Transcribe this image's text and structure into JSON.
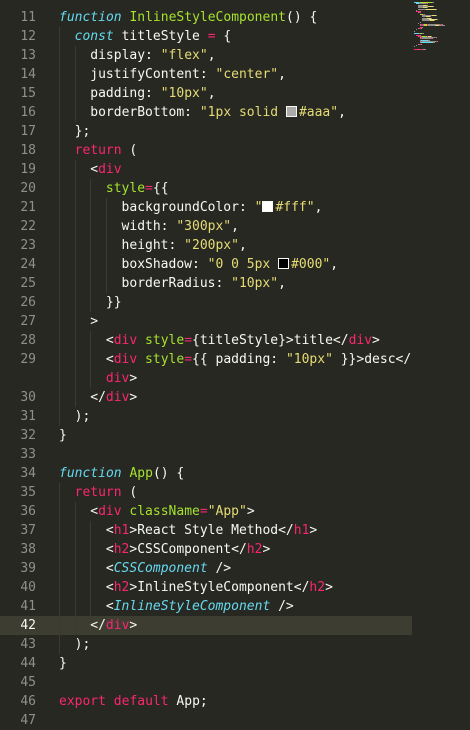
{
  "colors": {
    "background": "#272822",
    "active_line": "#3e3d32",
    "keyword": "#f92672",
    "function": "#a6e22e",
    "string": "#e6db74",
    "component": "#66d9ef",
    "text": "#f8f8f2",
    "line_number": "#90908a"
  },
  "editor": {
    "current_line": "42",
    "lines": [
      {
        "num": "11",
        "indent": 0,
        "tokens": [
          {
            "t": "function",
            "c": "kwi"
          },
          {
            "t": " "
          },
          {
            "t": "InlineStyleComponent",
            "c": "fn"
          },
          {
            "t": "() {"
          }
        ]
      },
      {
        "num": "12",
        "indent": 1,
        "tokens": [
          {
            "t": "const",
            "c": "kwi"
          },
          {
            "t": " titleStyle "
          },
          {
            "t": "=",
            "c": "kw"
          },
          {
            "t": " {"
          }
        ]
      },
      {
        "num": "13",
        "indent": 2,
        "tokens": [
          {
            "t": "display: "
          },
          {
            "t": "\"flex\"",
            "c": "str"
          },
          {
            "t": ","
          }
        ]
      },
      {
        "num": "14",
        "indent": 2,
        "tokens": [
          {
            "t": "justifyContent: "
          },
          {
            "t": "\"center\"",
            "c": "str"
          },
          {
            "t": ","
          }
        ]
      },
      {
        "num": "15",
        "indent": 2,
        "tokens": [
          {
            "t": "padding: "
          },
          {
            "t": "\"10px\"",
            "c": "str"
          },
          {
            "t": ","
          }
        ]
      },
      {
        "num": "16",
        "indent": 2,
        "tokens": [
          {
            "t": "borderBottom: "
          },
          {
            "t": "\"1px solid ",
            "c": "str"
          },
          {
            "t": "",
            "swatch": "#aaaaaa"
          },
          {
            "t": "#aaa\"",
            "c": "str"
          },
          {
            "t": ","
          }
        ]
      },
      {
        "num": "17",
        "indent": 1,
        "tokens": [
          {
            "t": "};"
          }
        ]
      },
      {
        "num": "18",
        "indent": 1,
        "tokens": [
          {
            "t": "return",
            "c": "kw"
          },
          {
            "t": " ("
          }
        ]
      },
      {
        "num": "19",
        "indent": 2,
        "tokens": [
          {
            "t": "<"
          },
          {
            "t": "div",
            "c": "tag"
          }
        ]
      },
      {
        "num": "20",
        "indent": 3,
        "tokens": [
          {
            "t": "style",
            "c": "attr"
          },
          {
            "t": "=",
            "c": "kw"
          },
          {
            "t": "{{"
          }
        ]
      },
      {
        "num": "21",
        "indent": 4,
        "tokens": [
          {
            "t": "backgroundColor: "
          },
          {
            "t": "\"",
            "c": "str"
          },
          {
            "t": "",
            "swatch": "#ffffff"
          },
          {
            "t": "#fff\"",
            "c": "str"
          },
          {
            "t": ","
          }
        ]
      },
      {
        "num": "22",
        "indent": 4,
        "tokens": [
          {
            "t": "width: "
          },
          {
            "t": "\"300px\"",
            "c": "str"
          },
          {
            "t": ","
          }
        ]
      },
      {
        "num": "23",
        "indent": 4,
        "tokens": [
          {
            "t": "height: "
          },
          {
            "t": "\"200px\"",
            "c": "str"
          },
          {
            "t": ","
          }
        ]
      },
      {
        "num": "24",
        "indent": 4,
        "tokens": [
          {
            "t": "boxShadow: "
          },
          {
            "t": "\"0 0 5px ",
            "c": "str"
          },
          {
            "t": "",
            "swatch": "#000000"
          },
          {
            "t": "#000\"",
            "c": "str"
          },
          {
            "t": ","
          }
        ]
      },
      {
        "num": "25",
        "indent": 4,
        "tokens": [
          {
            "t": "borderRadius: "
          },
          {
            "t": "\"10px\"",
            "c": "str"
          },
          {
            "t": ","
          }
        ]
      },
      {
        "num": "26",
        "indent": 3,
        "tokens": [
          {
            "t": "}}"
          }
        ]
      },
      {
        "num": "27",
        "indent": 2,
        "tokens": [
          {
            "t": ">"
          }
        ]
      },
      {
        "num": "28",
        "indent": 3,
        "tokens": [
          {
            "t": "<"
          },
          {
            "t": "div",
            "c": "tag"
          },
          {
            "t": " "
          },
          {
            "t": "style",
            "c": "attr"
          },
          {
            "t": "=",
            "c": "kw"
          },
          {
            "t": "{titleStyle}>title</"
          },
          {
            "t": "div",
            "c": "tag"
          },
          {
            "t": ">"
          }
        ]
      },
      {
        "num": "29",
        "indent": 3,
        "tokens": [
          {
            "t": "<"
          },
          {
            "t": "div",
            "c": "tag"
          },
          {
            "t": " "
          },
          {
            "t": "style",
            "c": "attr"
          },
          {
            "t": "=",
            "c": "kw"
          },
          {
            "t": "{{ padding: "
          },
          {
            "t": "\"10px\"",
            "c": "str"
          },
          {
            "t": " }}>desc</"
          }
        ]
      },
      {
        "num": "",
        "indent": 3,
        "tokens": [
          {
            "t": "div",
            "c": "tag"
          },
          {
            "t": ">"
          }
        ]
      },
      {
        "num": "30",
        "indent": 2,
        "tokens": [
          {
            "t": "</"
          },
          {
            "t": "div",
            "c": "tag"
          },
          {
            "t": ">"
          }
        ]
      },
      {
        "num": "31",
        "indent": 1,
        "tokens": [
          {
            "t": ");"
          }
        ]
      },
      {
        "num": "32",
        "indent": 0,
        "tokens": [
          {
            "t": "}"
          }
        ]
      },
      {
        "num": "33",
        "indent": 0,
        "tokens": []
      },
      {
        "num": "34",
        "indent": 0,
        "tokens": [
          {
            "t": "function",
            "c": "kwi"
          },
          {
            "t": " "
          },
          {
            "t": "App",
            "c": "fn"
          },
          {
            "t": "() {"
          }
        ]
      },
      {
        "num": "35",
        "indent": 1,
        "tokens": [
          {
            "t": "return",
            "c": "kw"
          },
          {
            "t": " ("
          }
        ]
      },
      {
        "num": "36",
        "indent": 2,
        "tokens": [
          {
            "t": "<"
          },
          {
            "t": "div",
            "c": "tag"
          },
          {
            "t": " "
          },
          {
            "t": "className",
            "c": "attr"
          },
          {
            "t": "=",
            "c": "kw"
          },
          {
            "t": "\"App\"",
            "c": "str"
          },
          {
            "t": ">"
          }
        ]
      },
      {
        "num": "37",
        "indent": 3,
        "tokens": [
          {
            "t": "<"
          },
          {
            "t": "h1",
            "c": "tag"
          },
          {
            "t": ">React Style Method</"
          },
          {
            "t": "h1",
            "c": "tag"
          },
          {
            "t": ">"
          }
        ]
      },
      {
        "num": "38",
        "indent": 3,
        "tokens": [
          {
            "t": "<"
          },
          {
            "t": "h2",
            "c": "tag"
          },
          {
            "t": ">CSSComponent</"
          },
          {
            "t": "h2",
            "c": "tag"
          },
          {
            "t": ">"
          }
        ]
      },
      {
        "num": "39",
        "indent": 3,
        "tokens": [
          {
            "t": "<"
          },
          {
            "t": "CSSComponent",
            "c": "comp"
          },
          {
            "t": " />"
          }
        ]
      },
      {
        "num": "40",
        "indent": 3,
        "tokens": [
          {
            "t": "<"
          },
          {
            "t": "h2",
            "c": "tag"
          },
          {
            "t": ">InlineStyleComponent</"
          },
          {
            "t": "h2",
            "c": "tag"
          },
          {
            "t": ">"
          }
        ]
      },
      {
        "num": "41",
        "indent": 3,
        "tokens": [
          {
            "t": "<"
          },
          {
            "t": "InlineStyleComponent",
            "c": "comp"
          },
          {
            "t": " />"
          }
        ]
      },
      {
        "num": "42",
        "indent": 2,
        "tokens": [
          {
            "t": "</"
          },
          {
            "t": "div",
            "c": "tag"
          },
          {
            "t": ">"
          }
        ]
      },
      {
        "num": "43",
        "indent": 1,
        "tokens": [
          {
            "t": ");"
          }
        ]
      },
      {
        "num": "44",
        "indent": 0,
        "tokens": [
          {
            "t": "}"
          }
        ]
      },
      {
        "num": "45",
        "indent": 0,
        "tokens": []
      },
      {
        "num": "46",
        "indent": 0,
        "tokens": [
          {
            "t": "export",
            "c": "kw"
          },
          {
            "t": " "
          },
          {
            "t": "default",
            "c": "kw"
          },
          {
            "t": " App;"
          }
        ]
      },
      {
        "num": "47",
        "indent": 0,
        "tokens": []
      }
    ]
  }
}
